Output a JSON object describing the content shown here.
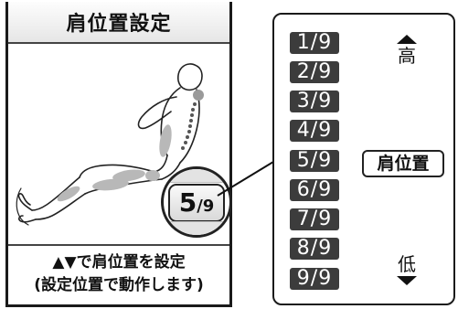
{
  "panel": {
    "title": "肩位置設定",
    "current_value": "5",
    "current_total": "/9",
    "instruction_line1": "▲▼で肩位置を設定",
    "instruction_line2": "(設定位置で動作します)"
  },
  "legend": {
    "levels": [
      "1/9",
      "2/9",
      "3/9",
      "4/9",
      "5/9",
      "6/9",
      "7/9",
      "8/9",
      "9/9"
    ],
    "high_label": "高",
    "low_label": "低",
    "shoulder_label": "肩位置"
  },
  "icons": {
    "up": "triangle-up-icon",
    "down": "triangle-down-icon",
    "figure": "reclined-person-icon"
  },
  "colors": {
    "level_badge": "#3c3c3c",
    "highlight": "#bdbdbd"
  }
}
